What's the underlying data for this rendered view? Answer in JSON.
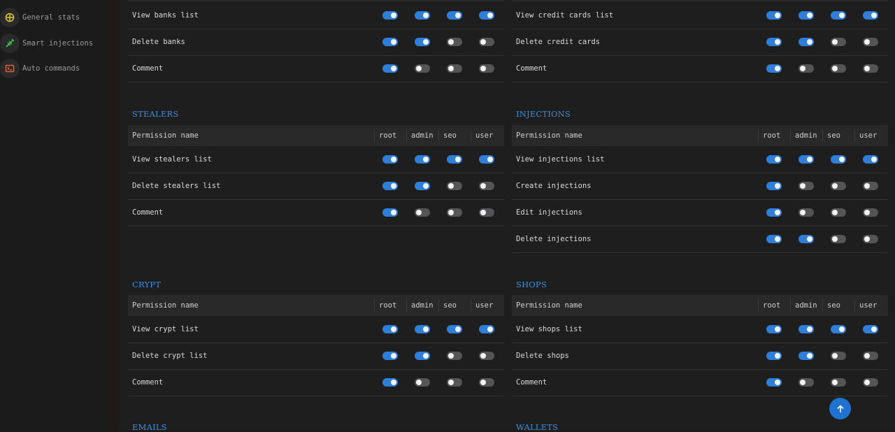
{
  "sidebar": {
    "items": [
      {
        "label": "General stats",
        "icon": "target-icon",
        "color": "#d8c23a"
      },
      {
        "label": "Smart injections",
        "icon": "syringe-icon",
        "color": "#3fbf4c"
      },
      {
        "label": "Auto commands",
        "icon": "terminal-icon",
        "color": "#e0623a"
      }
    ]
  },
  "roles": [
    "root",
    "admin",
    "seo",
    "user"
  ],
  "header_label": "Permission name",
  "panels": {
    "banks": {
      "title": "",
      "rows": [
        {
          "name": "View banks list",
          "perms": [
            true,
            true,
            true,
            true
          ]
        },
        {
          "name": "Delete banks",
          "perms": [
            true,
            true,
            false,
            false
          ]
        },
        {
          "name": "Comment",
          "perms": [
            true,
            false,
            false,
            false
          ]
        }
      ]
    },
    "credit_cards": {
      "title": "",
      "rows": [
        {
          "name": "View credit cards list",
          "perms": [
            true,
            true,
            true,
            true
          ]
        },
        {
          "name": "Delete credit cards",
          "perms": [
            true,
            true,
            false,
            false
          ]
        },
        {
          "name": "Comment",
          "perms": [
            true,
            false,
            false,
            false
          ]
        }
      ]
    },
    "stealers": {
      "title": "STEALERS",
      "rows": [
        {
          "name": "View stealers list",
          "perms": [
            true,
            true,
            true,
            true
          ]
        },
        {
          "name": "Delete stealers list",
          "perms": [
            true,
            true,
            false,
            false
          ]
        },
        {
          "name": "Comment",
          "perms": [
            true,
            false,
            false,
            false
          ]
        }
      ]
    },
    "injections": {
      "title": "INJECTIONS",
      "rows": [
        {
          "name": "View injections list",
          "perms": [
            true,
            true,
            true,
            true
          ]
        },
        {
          "name": "Create injections",
          "perms": [
            true,
            false,
            false,
            false
          ]
        },
        {
          "name": "Edit injections",
          "perms": [
            true,
            false,
            false,
            false
          ]
        },
        {
          "name": "Delete injections",
          "perms": [
            true,
            true,
            false,
            false
          ]
        }
      ]
    },
    "crypt": {
      "title": "CRYPT",
      "rows": [
        {
          "name": "View crypt list",
          "perms": [
            true,
            true,
            true,
            true
          ]
        },
        {
          "name": "Delete crypt list",
          "perms": [
            true,
            true,
            false,
            false
          ]
        },
        {
          "name": "Comment",
          "perms": [
            true,
            false,
            false,
            false
          ]
        }
      ]
    },
    "shops": {
      "title": "SHOPS",
      "rows": [
        {
          "name": "View shops list",
          "perms": [
            true,
            true,
            true,
            true
          ]
        },
        {
          "name": "Delete shops",
          "perms": [
            true,
            true,
            false,
            false
          ]
        },
        {
          "name": "Comment",
          "perms": [
            true,
            false,
            false,
            false
          ]
        }
      ]
    },
    "emails": {
      "title": "EMAILS",
      "rows": []
    },
    "wallets": {
      "title": "WALLETS",
      "rows": []
    }
  },
  "scroll_top_icon": "arrow-up-icon"
}
